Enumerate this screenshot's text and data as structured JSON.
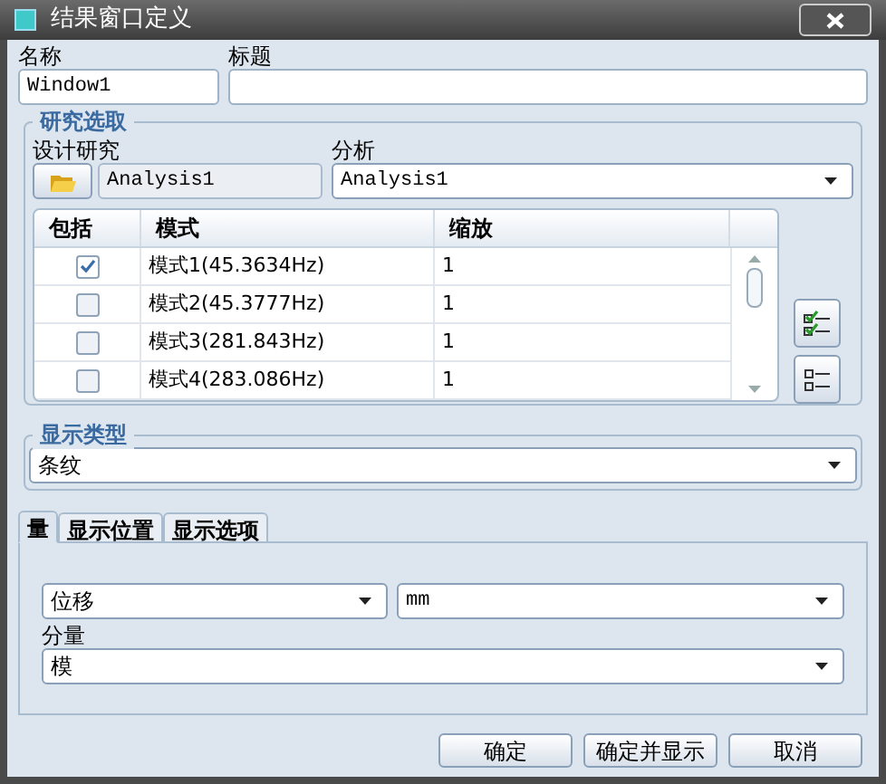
{
  "window": {
    "title": "结果窗口定义"
  },
  "name_field": {
    "label": "名称",
    "value": "Window1"
  },
  "title_field": {
    "label": "标题"
  },
  "study_group": {
    "legend": "研究选取",
    "design_label": "设计研究",
    "design_value": "Analysis1",
    "analysis_label": "分析",
    "analysis_value": "Analysis1",
    "table": {
      "columns": [
        "包括",
        "模式",
        "缩放"
      ],
      "rows": [
        {
          "checked": true,
          "mode": "模式1(45.3634Hz)",
          "scale": "1"
        },
        {
          "checked": false,
          "mode": "模式2(45.3777Hz)",
          "scale": "1"
        },
        {
          "checked": false,
          "mode": "模式3(281.843Hz)",
          "scale": "1"
        },
        {
          "checked": false,
          "mode": "模式4(283.086Hz)",
          "scale": "1"
        }
      ]
    }
  },
  "display_type": {
    "legend": "显示类型",
    "value": "条纹"
  },
  "tabs": [
    {
      "label": "量",
      "selected": true
    },
    {
      "label": "显示位置",
      "selected": false
    },
    {
      "label": "显示选项",
      "selected": false
    }
  ],
  "quantity": {
    "value": "位移",
    "unit": "mm",
    "component_label": "分量",
    "component_value": "模"
  },
  "buttons": [
    "确定",
    "确定并显示",
    "取消"
  ]
}
